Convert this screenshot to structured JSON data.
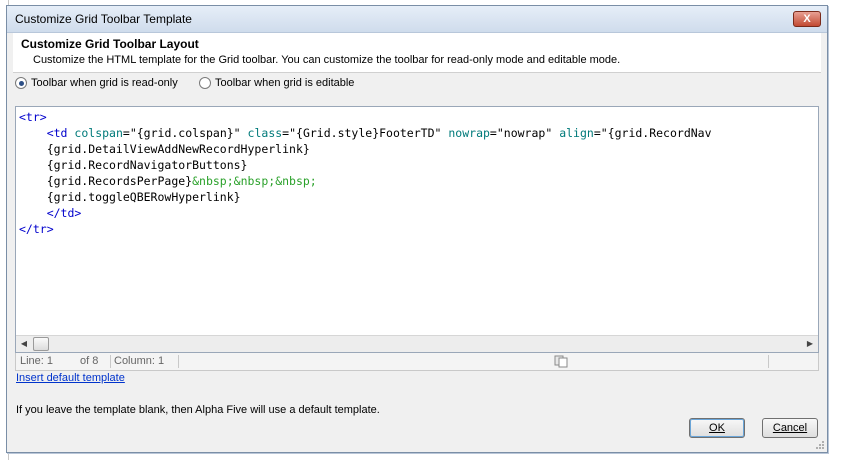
{
  "window": {
    "title": "Customize Grid Toolbar Template",
    "close_label": "X"
  },
  "header": {
    "title": "Customize Grid Toolbar Layout",
    "description": "Customize the HTML template for the Grid toolbar. You can customize the toolbar for read-only mode and editable mode."
  },
  "mode_options": [
    {
      "label": "Toolbar when grid is read-only",
      "selected": true
    },
    {
      "label": "Toolbar when grid is editable",
      "selected": false
    }
  ],
  "editor": {
    "lines": [
      "<tr>",
      "    <td colspan=\"{grid.colspan}\" class=\"{Grid.style}FooterTD\" nowrap=\"nowrap\" align=\"{grid.RecordNav",
      "    {grid.DetailViewAddNewRecordHyperlink}",
      "    {grid.RecordNavigatorButtons}",
      "    {grid.RecordsPerPage}&nbsp;&nbsp;&nbsp;",
      "    {grid.toggleQBERowHyperlink}",
      "    </td>",
      "</tr>"
    ]
  },
  "status": {
    "line_label": "Line: 1",
    "of_label": "of 8",
    "column_label": "Column: 1"
  },
  "links": {
    "insert_default": "Insert default template"
  },
  "note": "If you leave the template blank, then Alpha Five will use a default template.",
  "buttons": {
    "ok": "OK",
    "cancel": "Cancel"
  },
  "colors": {
    "tag": "#0000cc",
    "attribute": "#007a7a",
    "entity": "#2aa12a",
    "link": "#0033cc"
  }
}
